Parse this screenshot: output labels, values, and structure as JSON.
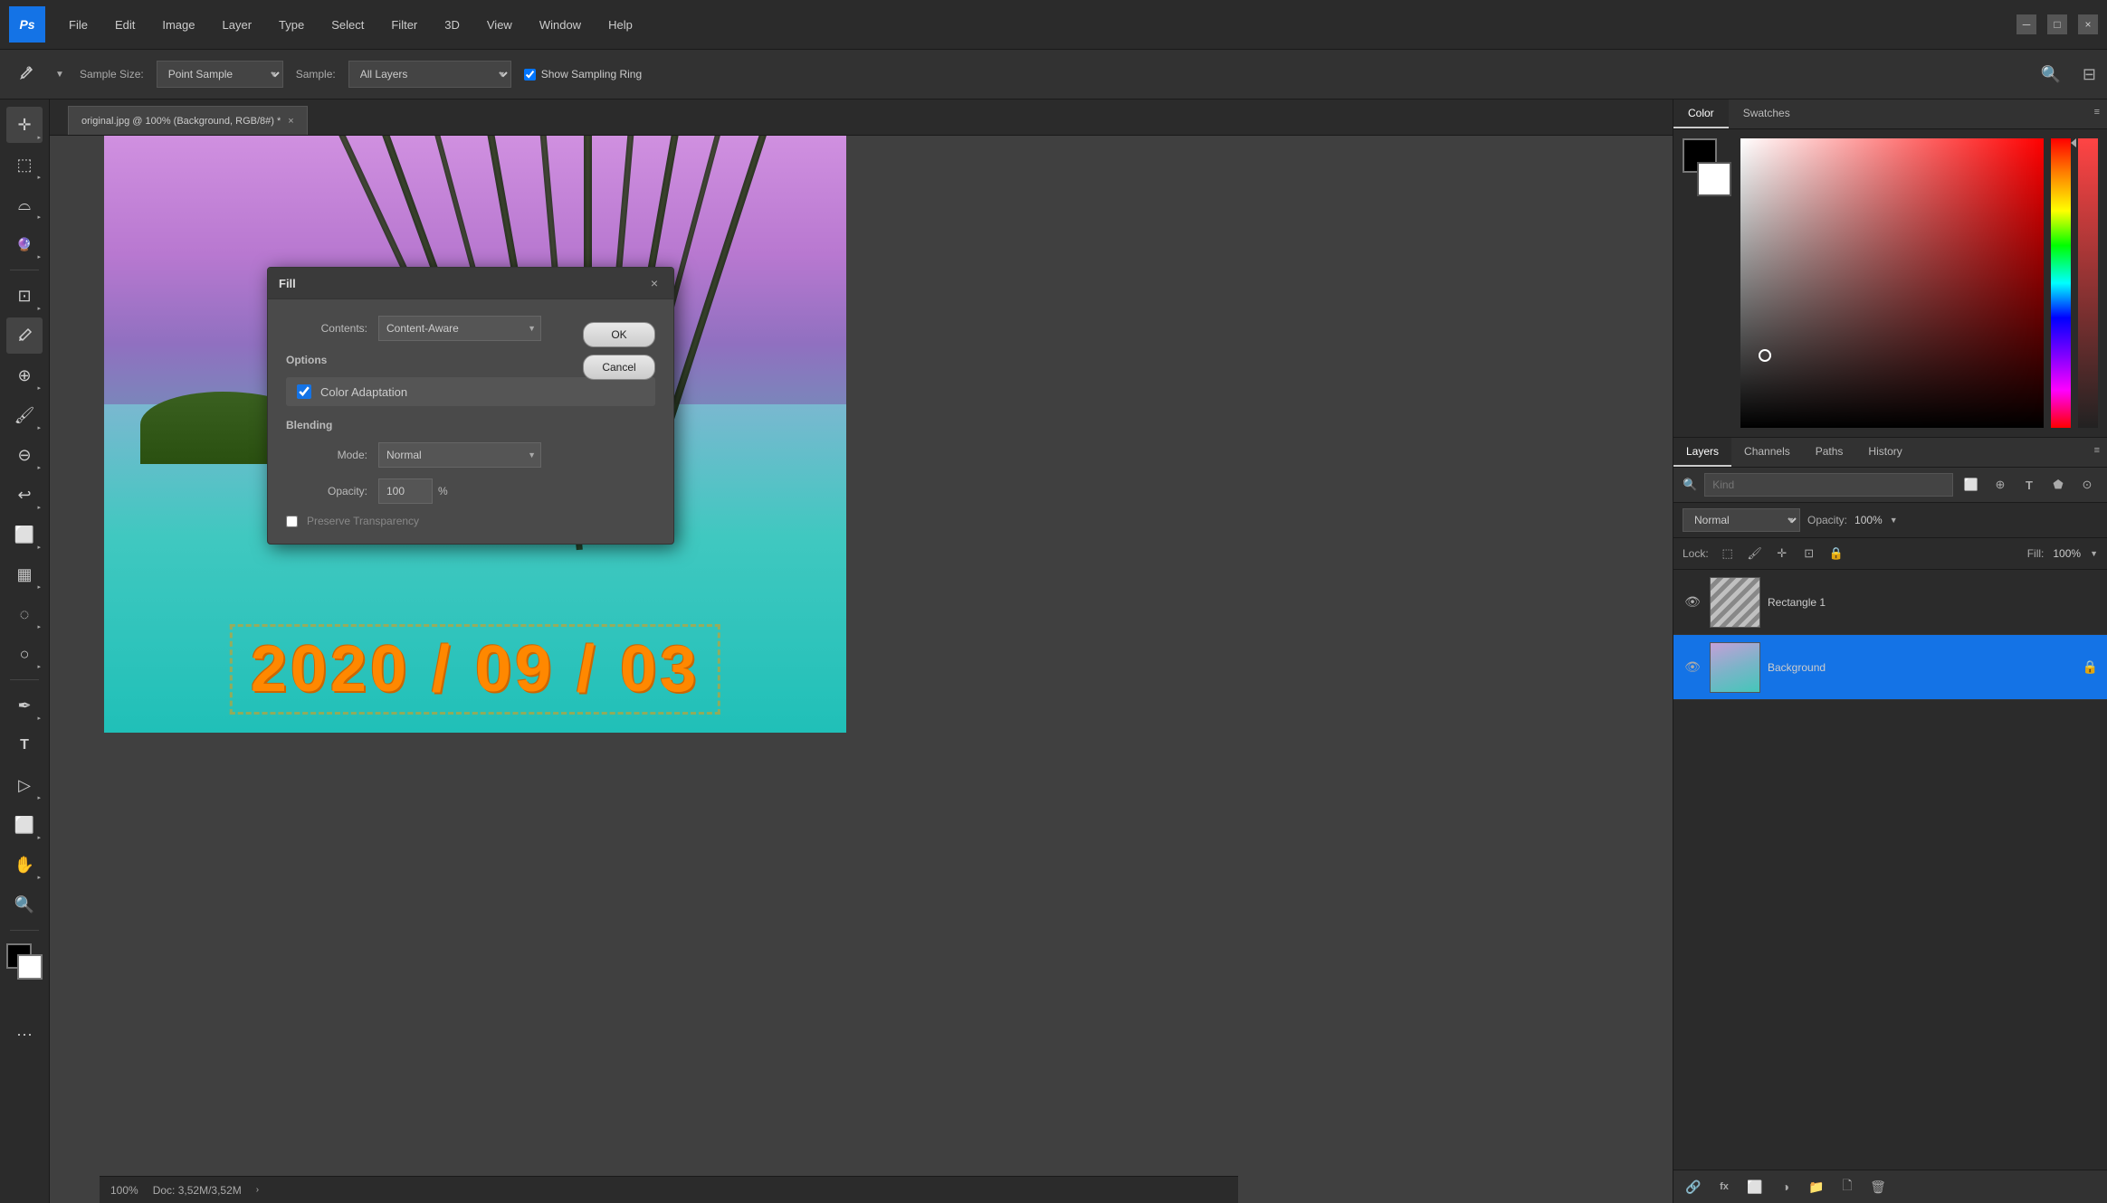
{
  "app": {
    "title": "Ps",
    "menu_items": [
      "File",
      "Edit",
      "Image",
      "Layer",
      "Type",
      "Select",
      "Filter",
      "3D",
      "View",
      "Window",
      "Help"
    ]
  },
  "toolbar": {
    "sample_size_label": "Sample Size:",
    "sample_size_value": "Point Sample",
    "sample_label": "Sample:",
    "sample_value": "All Layers",
    "show_sampling_ring": "Show Sampling Ring",
    "tool_icon": "✱"
  },
  "tab": {
    "filename": "original.jpg @ 100% (Background, RGB/8#) *",
    "close_icon": "×"
  },
  "canvas": {
    "date_text": "2020 / 09 / 03"
  },
  "fill_dialog": {
    "title": "Fill",
    "close_icon": "×",
    "contents_label": "Contents:",
    "contents_value": "Content-Aware",
    "options_label": "Options",
    "color_adaptation_label": "Color Adaptation",
    "blending_label": "Blending",
    "mode_label": "Mode:",
    "mode_value": "Normal",
    "opacity_label": "Opacity:",
    "opacity_value": "100",
    "opacity_unit": "%",
    "preserve_label": "Preserve Transparency",
    "ok_label": "OK",
    "cancel_label": "Cancel"
  },
  "color_panel": {
    "tab_color": "Color",
    "tab_swatches": "Swatches"
  },
  "layers_panel": {
    "tab_layers": "Layers",
    "tab_channels": "Channels",
    "tab_paths": "Paths",
    "tab_history": "History",
    "kind_placeholder": "Kind",
    "blend_mode": "Normal",
    "opacity_label": "Opacity:",
    "opacity_value": "100%",
    "lock_label": "Lock:",
    "fill_label": "Fill:",
    "fill_value": "100%",
    "layers": [
      {
        "name": "Rectangle 1",
        "type": "shape",
        "visible": true
      },
      {
        "name": "Background",
        "type": "image",
        "visible": true,
        "locked": true
      }
    ]
  },
  "status_bar": {
    "zoom": "100%",
    "doc_info": "Doc: 3,52M/3,52M",
    "arrow": "›"
  }
}
